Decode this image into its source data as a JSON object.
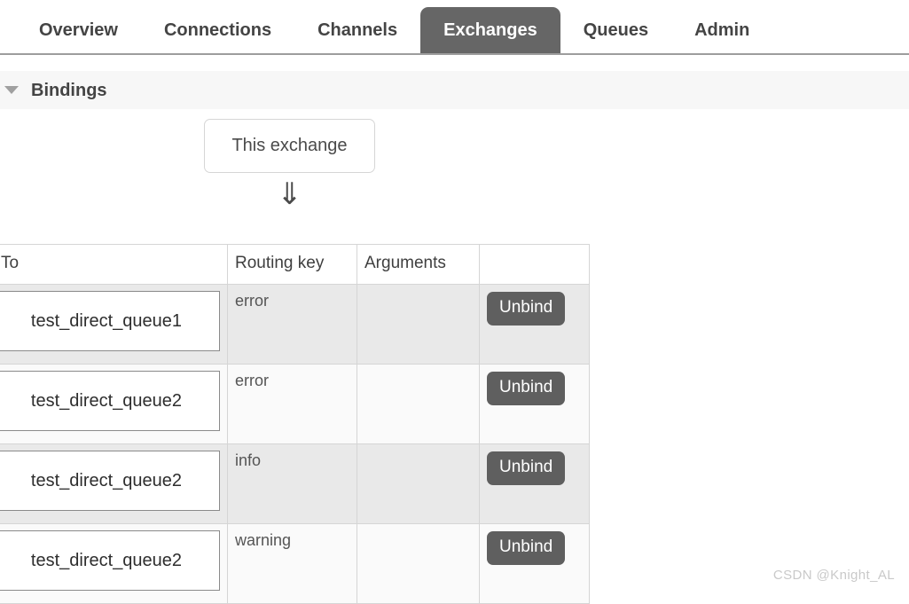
{
  "nav": {
    "tabs": [
      {
        "label": "Overview",
        "active": false
      },
      {
        "label": "Connections",
        "active": false
      },
      {
        "label": "Channels",
        "active": false
      },
      {
        "label": "Exchanges",
        "active": true
      },
      {
        "label": "Queues",
        "active": false
      },
      {
        "label": "Admin",
        "active": false
      }
    ]
  },
  "section": {
    "title": "Bindings",
    "collapse_icon": "triangle-down-icon"
  },
  "diagram": {
    "source_label": "This exchange",
    "arrow_glyph": "⇓",
    "arrow_icon": "double-down-arrow-icon"
  },
  "table": {
    "headers": [
      "To",
      "Routing key",
      "Arguments",
      ""
    ],
    "action_label": "Unbind",
    "rows": [
      {
        "to": "test_direct_queue1",
        "routing_key": "error",
        "arguments": "",
        "action": "Unbind"
      },
      {
        "to": "test_direct_queue2",
        "routing_key": "error",
        "arguments": "",
        "action": "Unbind"
      },
      {
        "to": "test_direct_queue2",
        "routing_key": "info",
        "arguments": "",
        "action": "Unbind"
      },
      {
        "to": "test_direct_queue2",
        "routing_key": "warning",
        "arguments": "",
        "action": "Unbind"
      }
    ]
  },
  "watermark": {
    "text": "CSDN @Knight_AL"
  },
  "colors": {
    "active_tab_bg": "#666666",
    "tab_text": "#444444",
    "section_bg": "#f7f7f7",
    "unbind_bg": "#5f5f5f",
    "row_odd": "#e9e9e9",
    "row_even": "#fafafa",
    "border": "#d5d5d5"
  }
}
